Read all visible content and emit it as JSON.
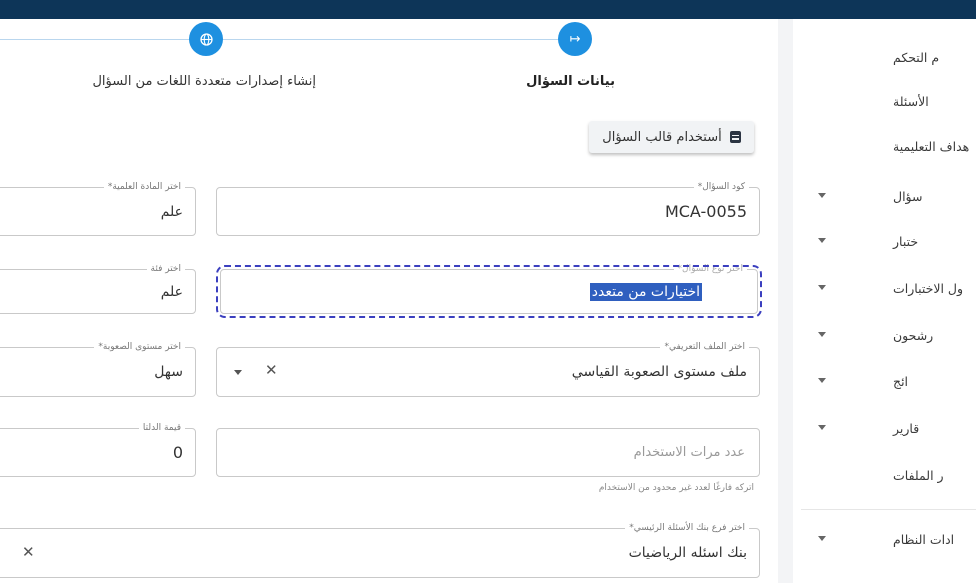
{
  "sidebar": {
    "items": [
      {
        "label": "م التحكم",
        "has_caret": false
      },
      {
        "label": "الأسئلة",
        "has_caret": false
      },
      {
        "label": "هداف التعليمية",
        "has_caret": false
      },
      {
        "label": "سؤال",
        "has_caret": true
      },
      {
        "label": "ختبار",
        "has_caret": true
      },
      {
        "label": "ول الاختبارات",
        "has_caret": true
      },
      {
        "label": "رشحون",
        "has_caret": true
      },
      {
        "label": "ائج",
        "has_caret": true
      },
      {
        "label": "قارير",
        "has_caret": true
      },
      {
        "label": "ر الملفات",
        "has_caret": false
      },
      {
        "label": "ادات النظام",
        "has_caret": true
      }
    ]
  },
  "stepper": {
    "step1_label": "بيانات السؤال",
    "step2_label": "إنشاء إصدارات متعددة اللغات من السؤال",
    "step1_icon": "arrow-right-to-bar-icon",
    "step2_icon": "globe-icon"
  },
  "template_button": {
    "label": "أستخدام قالب السؤال",
    "icon": "document-icon"
  },
  "form": {
    "question_code": {
      "label": "كود السؤال*",
      "value": "MCA-0055"
    },
    "subject": {
      "label": "اختر المادة العلمية*",
      "value": "علم"
    },
    "question_type": {
      "label": "اختر نوع السؤال*",
      "value": "اختيارات من متعدد"
    },
    "category": {
      "label": "اختر فئة",
      "value": "علم"
    },
    "profile": {
      "label": "اختر الملف التعريفي*",
      "value": "ملف مستوى الصعوبة القياسي"
    },
    "difficulty": {
      "label": "اختر مستوى الصعوبة*",
      "value": "سهل"
    },
    "usage_count": {
      "placeholder": "عدد مرات الاستخدام",
      "hint": "اتركه فارغًا لعدد غير محدود من الاستخدام"
    },
    "delta": {
      "label": "قيمة الدلتا",
      "value": "0"
    },
    "main_bank": {
      "label": "اختر فرع بنك الأسئلة الرئيسي*",
      "value": "بنك اسئله الرياضيات"
    }
  },
  "colors": {
    "topbar": "#0d3558",
    "accent": "#1e90e0",
    "focus": "#3b3fbf"
  }
}
